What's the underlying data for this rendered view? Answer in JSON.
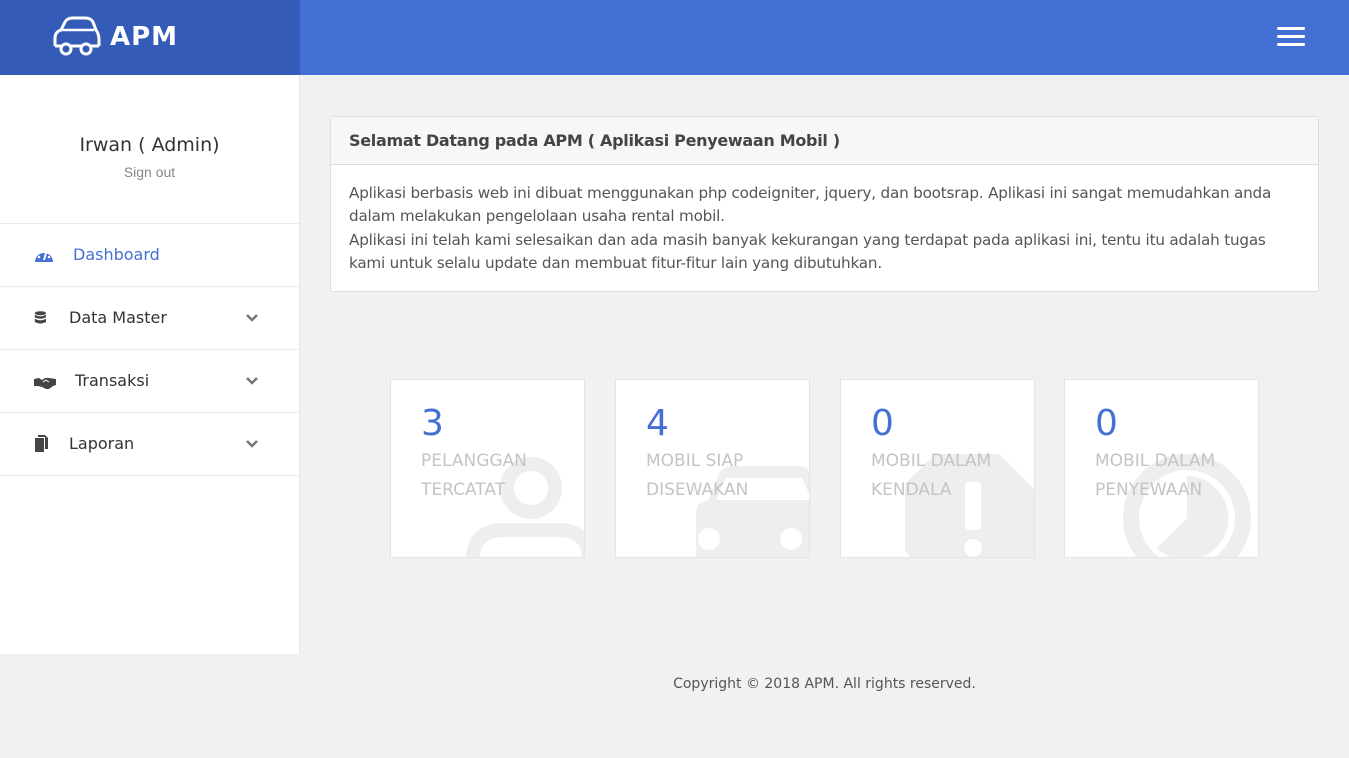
{
  "brand": {
    "name": "APM",
    "icon": "car-outline-icon"
  },
  "header": {
    "menu_icon": "hamburger-menu-icon"
  },
  "user": {
    "name": "Irwan ( Admin)",
    "sign_out": "Sign out"
  },
  "sidebar": {
    "items": [
      {
        "label": "Dashboard",
        "icon": "dashboard-gauge-icon",
        "active": true,
        "has_submenu": false
      },
      {
        "label": "Data Master",
        "icon": "database-icon",
        "active": false,
        "has_submenu": true
      },
      {
        "label": "Transaksi",
        "icon": "handshake-icon",
        "active": false,
        "has_submenu": true
      },
      {
        "label": "Laporan",
        "icon": "files-icon",
        "active": false,
        "has_submenu": true
      }
    ]
  },
  "welcome": {
    "title": "Selamat Datang pada APM ( Aplikasi Penyewaan Mobil )",
    "paragraph1": "Aplikasi berbasis web ini dibuat menggunakan php codeigniter, jquery, dan bootsrap. Aplikasi ini sangat memudahkan anda dalam melakukan pengelolaan usaha rental mobil.",
    "paragraph2": "Aplikasi ini telah kami selesaikan dan ada masih banyak kekurangan yang terdapat pada aplikasi ini, tentu itu adalah tugas kami untuk selalu update dan membuat fitur-fitur lain yang dibutuhkan."
  },
  "stats": [
    {
      "value": "3",
      "label": "PELANGGAN TERCATAT",
      "icon": "user-icon"
    },
    {
      "value": "4",
      "label": "MOBIL SIAP DISEWAKAN",
      "icon": "car-icon"
    },
    {
      "value": "0",
      "label": "MOBIL DALAM KENDALA",
      "icon": "warning-octagon-icon"
    },
    {
      "value": "0",
      "label": "MOBIL DALAM PENYEWAAN",
      "icon": "clock-icon"
    }
  ],
  "footer": {
    "text": "Copyright © 2018 APM. All rights reserved."
  },
  "colors": {
    "primary": "#4470d6",
    "brand_dark": "#355bb8",
    "background": "#f1f1f1",
    "stat_icon": "#eeeeee"
  }
}
